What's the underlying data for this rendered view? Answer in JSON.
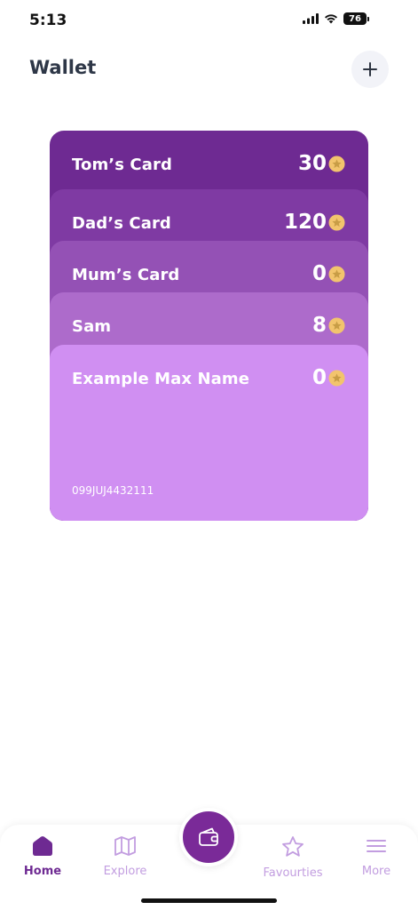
{
  "status": {
    "time": "5:13",
    "battery": "76"
  },
  "header": {
    "title": "Wallet"
  },
  "cards": [
    {
      "name": "Tom’s Card",
      "points": "30",
      "color": "#6e2a92"
    },
    {
      "name": "Dad’s Card",
      "points": "120",
      "color": "#7f3aa3"
    },
    {
      "name": "Mum’s Card",
      "points": "0",
      "color": "#9451b5"
    },
    {
      "name": "Sam",
      "points": "8",
      "color": "#ad6bcb"
    },
    {
      "name": "Example Max Name",
      "points": "0",
      "color": "#d08ff2",
      "number": "099JUJ4432111"
    }
  ],
  "star_color": "#f2c46d",
  "nav": {
    "home": "Home",
    "explore": "Explore",
    "favourites": "Favourties",
    "more": "More"
  }
}
